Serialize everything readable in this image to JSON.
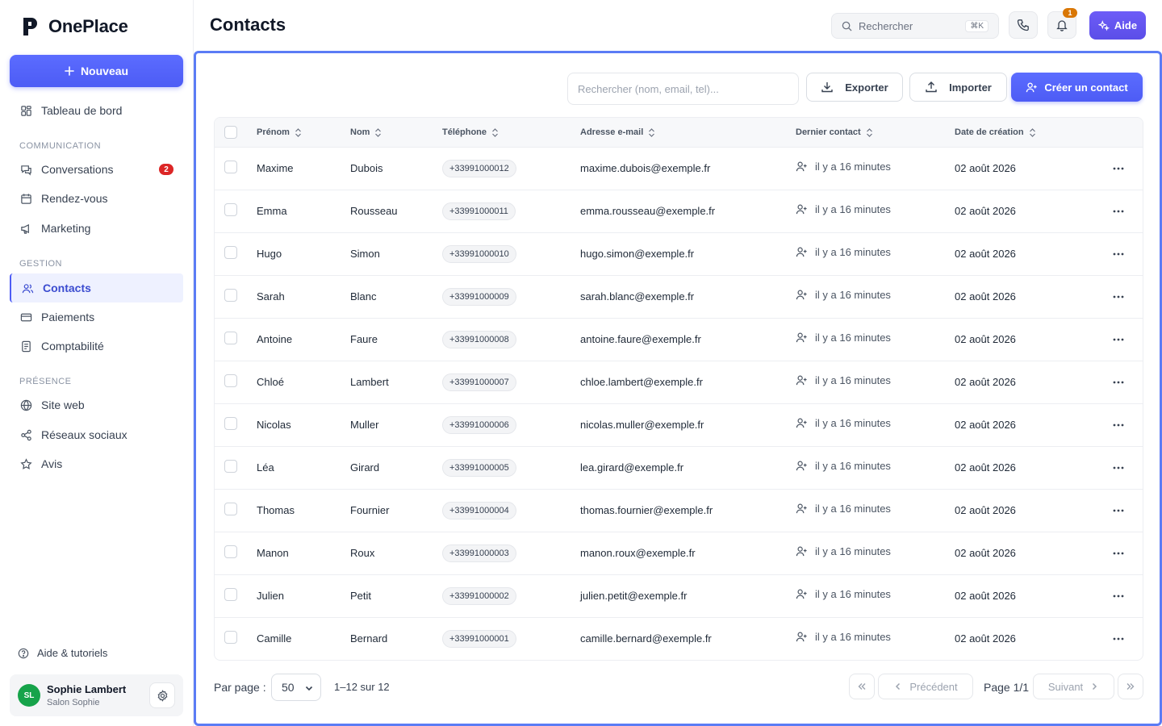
{
  "app": {
    "name": "OnePlace"
  },
  "sidebar": {
    "new_button": "Nouveau",
    "dashboard": "Tableau de bord",
    "sections": {
      "communication": "COMMUNICATION",
      "gestion": "GESTION",
      "presence": "PRÉSENCE"
    },
    "items": {
      "conversations": {
        "label": "Conversations",
        "badge": "2"
      },
      "rendez_vous": "Rendez-vous",
      "marketing": "Marketing",
      "contacts": "Contacts",
      "paiements": "Paiements",
      "comptabilite": "Comptabilité",
      "site_web": "Site web",
      "reseaux": "Réseaux sociaux",
      "avis": "Avis"
    },
    "help": "Aide & tutoriels",
    "user": {
      "initials": "SL",
      "name": "Sophie Lambert",
      "org": "Salon Sophie"
    }
  },
  "header": {
    "title": "Contacts",
    "search_placeholder": "Rechercher",
    "search_shortcut": "⌘K",
    "notifications_count": "1",
    "help_button": "Aide"
  },
  "toolbar": {
    "search_placeholder": "Rechercher (nom, email, tel)...",
    "export": "Exporter",
    "import": "Importer",
    "create": "Créer un contact"
  },
  "table": {
    "columns": [
      "Prénom",
      "Nom",
      "Téléphone",
      "Adresse e-mail",
      "Dernier contact",
      "Date de création"
    ],
    "rows": [
      {
        "first": "Maxime",
        "last": "Dubois",
        "phone": "+33991000012",
        "email": "maxime.dubois@exemple.fr",
        "last_contact": "il y a 16 minutes",
        "created": "02 août 2026"
      },
      {
        "first": "Emma",
        "last": "Rousseau",
        "phone": "+33991000011",
        "email": "emma.rousseau@exemple.fr",
        "last_contact": "il y a 16 minutes",
        "created": "02 août 2026"
      },
      {
        "first": "Hugo",
        "last": "Simon",
        "phone": "+33991000010",
        "email": "hugo.simon@exemple.fr",
        "last_contact": "il y a 16 minutes",
        "created": "02 août 2026"
      },
      {
        "first": "Sarah",
        "last": "Blanc",
        "phone": "+33991000009",
        "email": "sarah.blanc@exemple.fr",
        "last_contact": "il y a 16 minutes",
        "created": "02 août 2026"
      },
      {
        "first": "Antoine",
        "last": "Faure",
        "phone": "+33991000008",
        "email": "antoine.faure@exemple.fr",
        "last_contact": "il y a 16 minutes",
        "created": "02 août 2026"
      },
      {
        "first": "Chloé",
        "last": "Lambert",
        "phone": "+33991000007",
        "email": "chloe.lambert@exemple.fr",
        "last_contact": "il y a 16 minutes",
        "created": "02 août 2026"
      },
      {
        "first": "Nicolas",
        "last": "Muller",
        "phone": "+33991000006",
        "email": "nicolas.muller@exemple.fr",
        "last_contact": "il y a 16 minutes",
        "created": "02 août 2026"
      },
      {
        "first": "Léa",
        "last": "Girard",
        "phone": "+33991000005",
        "email": "lea.girard@exemple.fr",
        "last_contact": "il y a 16 minutes",
        "created": "02 août 2026"
      },
      {
        "first": "Thomas",
        "last": "Fournier",
        "phone": "+33991000004",
        "email": "thomas.fournier@exemple.fr",
        "last_contact": "il y a 16 minutes",
        "created": "02 août 2026"
      },
      {
        "first": "Manon",
        "last": "Roux",
        "phone": "+33991000003",
        "email": "manon.roux@exemple.fr",
        "last_contact": "il y a 16 minutes",
        "created": "02 août 2026"
      },
      {
        "first": "Julien",
        "last": "Petit",
        "phone": "+33991000002",
        "email": "julien.petit@exemple.fr",
        "last_contact": "il y a 16 minutes",
        "created": "02 août 2026"
      },
      {
        "first": "Camille",
        "last": "Bernard",
        "phone": "+33991000001",
        "email": "camille.bernard@exemple.fr",
        "last_contact": "il y a 16 minutes",
        "created": "02 août 2026"
      }
    ]
  },
  "pagination": {
    "per_page_label": "Par page :",
    "per_page_value": "50",
    "range": "1–12 sur 12",
    "previous": "Précédent",
    "page": "Page 1/1",
    "next": "Suivant"
  },
  "colors": {
    "accent": "#4d5cf5",
    "aide": "#5b4ee8",
    "badge_red": "#dc2626",
    "badge_orange": "#d97706",
    "avatar": "#16a34a"
  }
}
